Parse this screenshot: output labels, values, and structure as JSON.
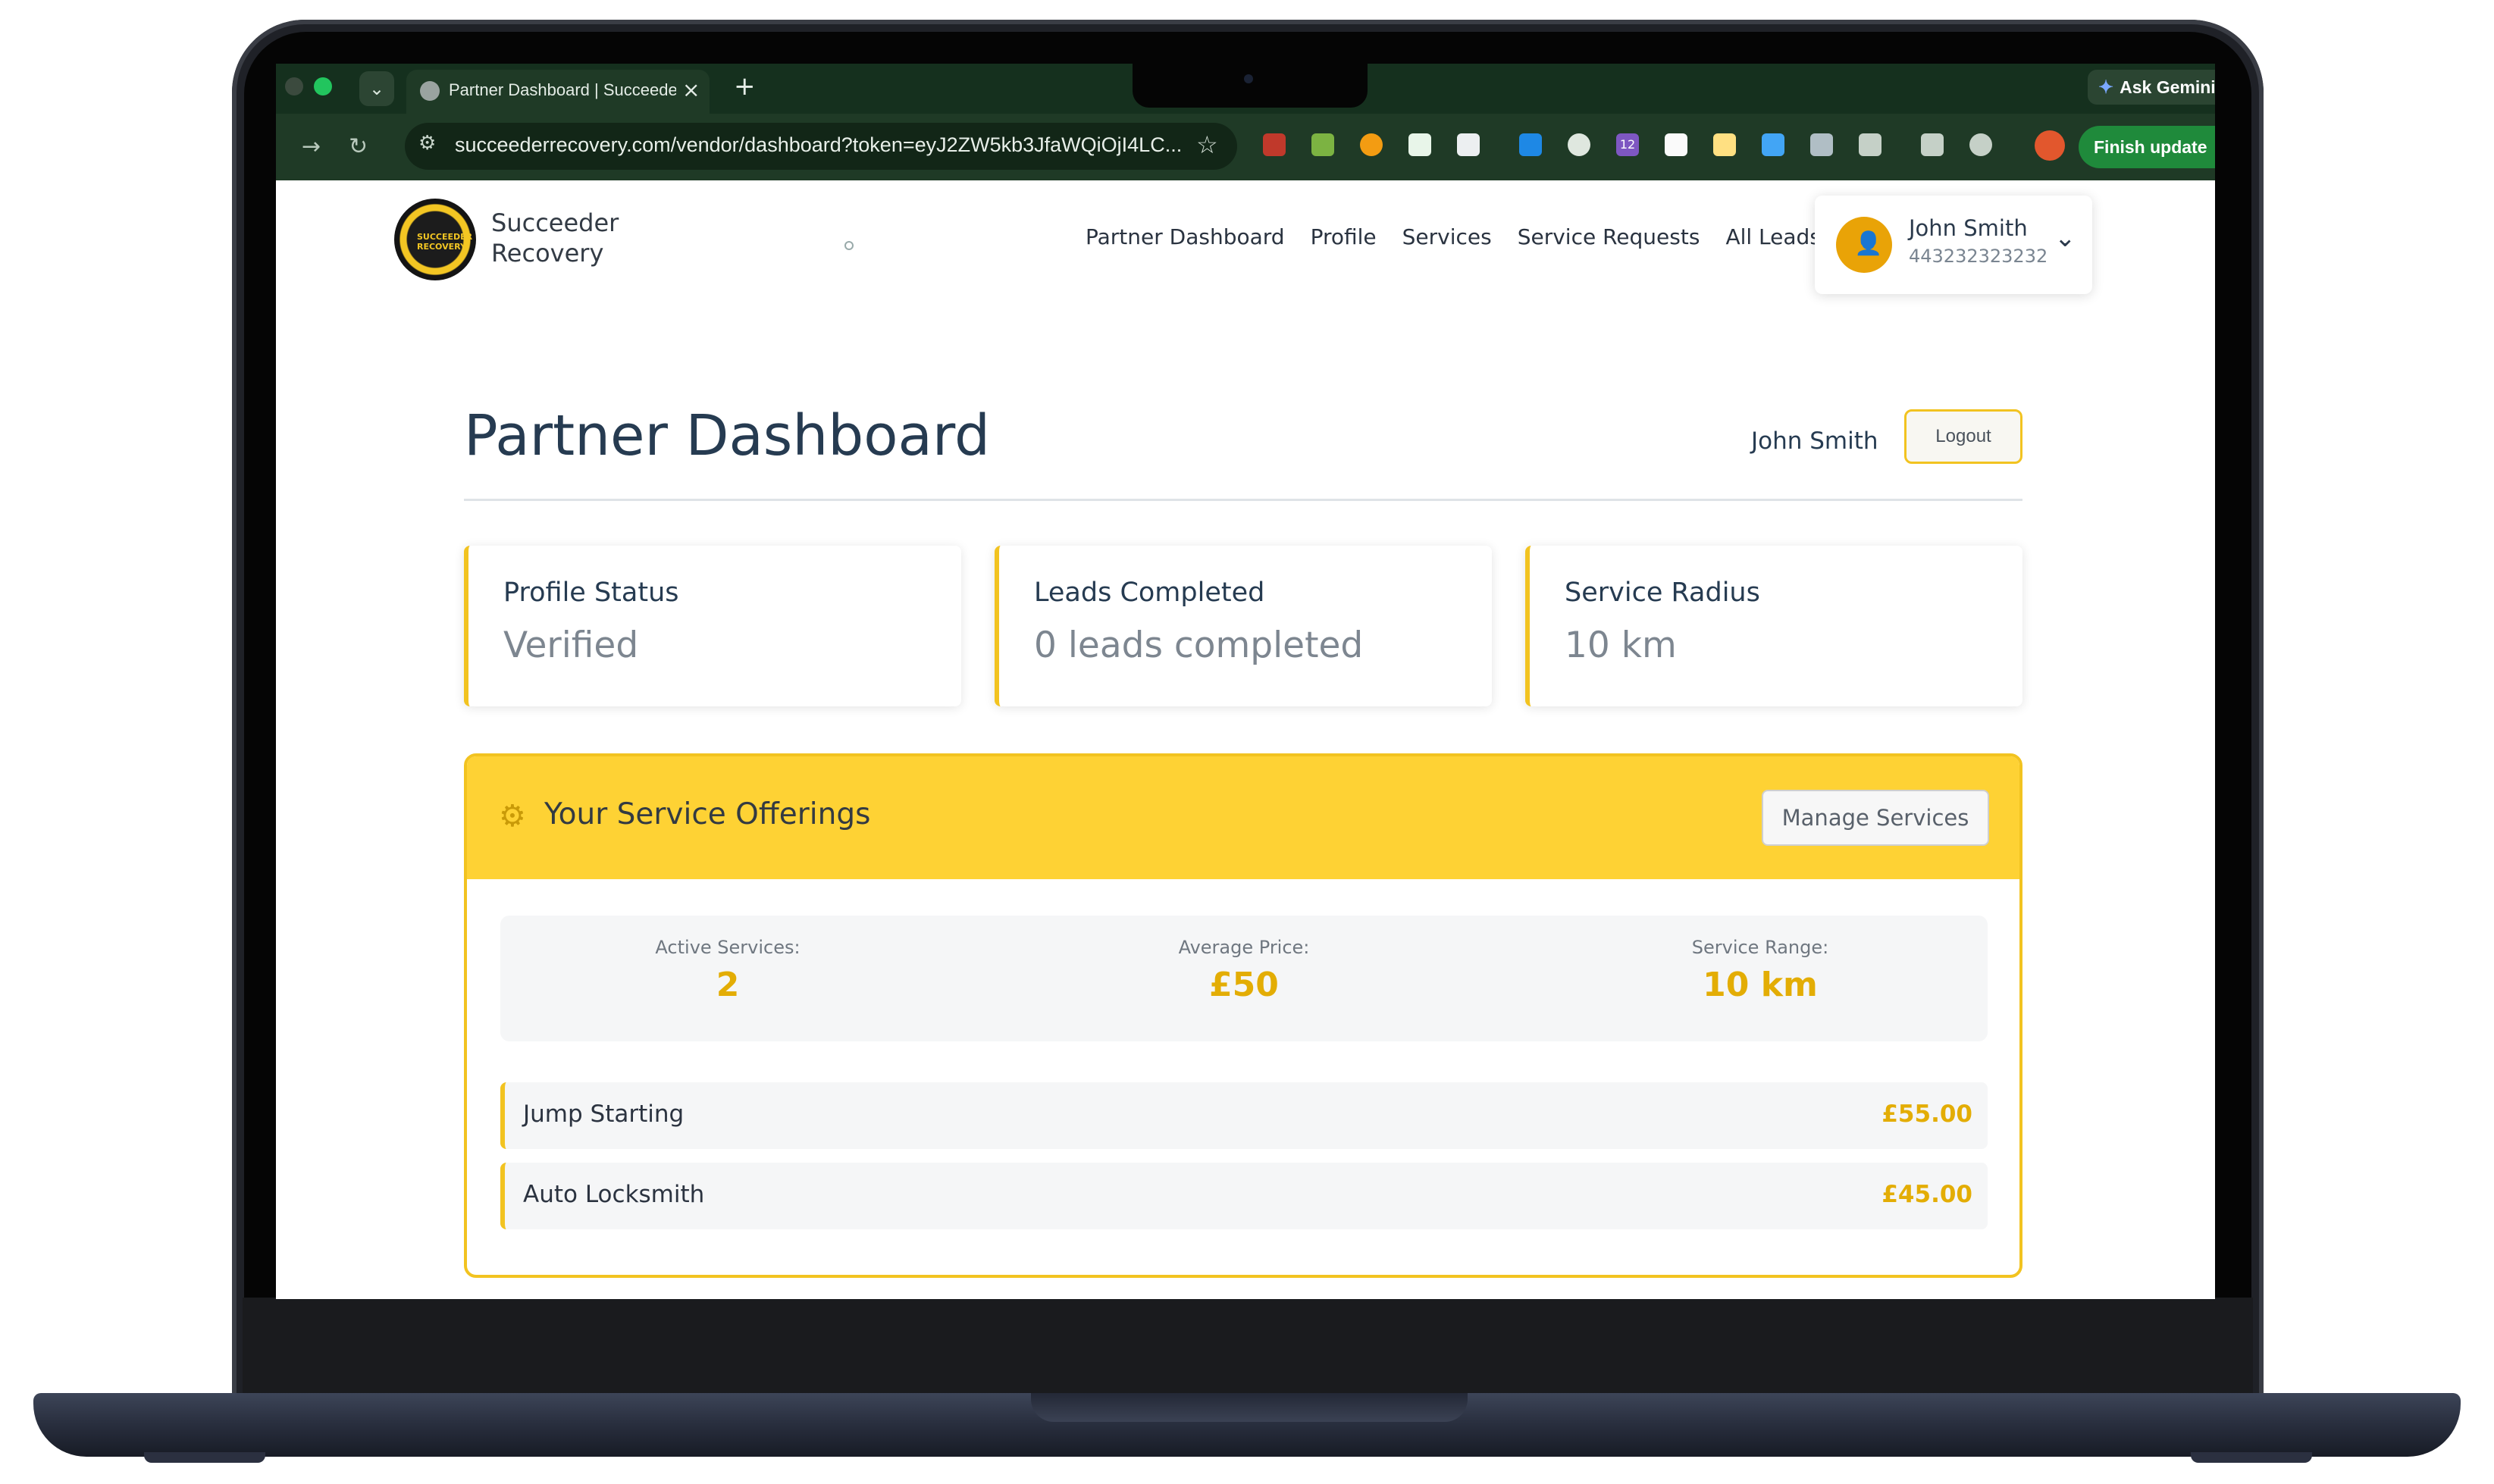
{
  "browser": {
    "tab_title": "Partner Dashboard | Succeeder",
    "ask_gemini": "Ask Gemini",
    "url": "succeederrecovery.com/vendor/dashboard?token=eyJ2ZW5kb3JfaWQiOjI4LC...",
    "finish_update": "Finish update",
    "extension_badge": "12"
  },
  "site": {
    "brand_name": "Succeeder Recovery",
    "logo_text": "SUCCEEDER RECOVERY",
    "nav": [
      "Partner Dashboard",
      "Profile",
      "Services",
      "Service Requests",
      "All Leads"
    ],
    "user": {
      "name": "John Smith",
      "phone": "443232323232"
    }
  },
  "dashboard": {
    "title": "Partner Dashboard",
    "username": "John Smith",
    "logout_label": "Logout",
    "stats": [
      {
        "label": "Profile Status",
        "value": "Verified"
      },
      {
        "label": "Leads Completed",
        "value": "0 leads completed"
      },
      {
        "label": "Service Radius",
        "value": "10 km"
      }
    ]
  },
  "offerings": {
    "title": "Your Service Offerings",
    "manage_label": "Manage Services",
    "summary": [
      {
        "label": "Active Services:",
        "value": "2"
      },
      {
        "label": "Average Price:",
        "value": "£50"
      },
      {
        "label": "Service Range:",
        "value": "10 km"
      }
    ],
    "services": [
      {
        "name": "Jump Starting",
        "price": "£55.00"
      },
      {
        "name": "Auto Locksmith",
        "price": "£45.00"
      }
    ]
  },
  "colors": {
    "accent_yellow": "#f2c320",
    "header_yellow": "#fed234",
    "price_gold": "#e3ad05",
    "heading_navy": "#263b51",
    "browser_green": "#1f3a26"
  }
}
